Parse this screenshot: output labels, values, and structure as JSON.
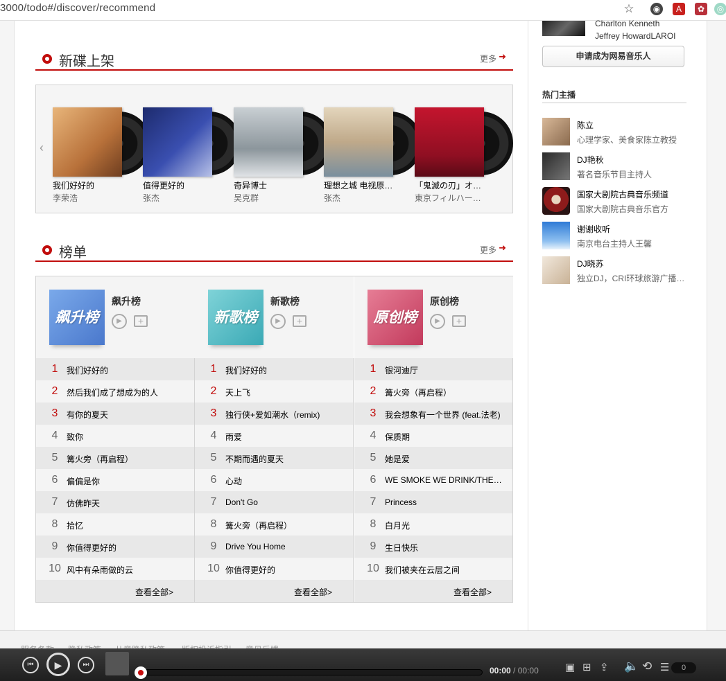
{
  "browser": {
    "url": "3000/todo#/discover/recommend"
  },
  "new_albums": {
    "title": "新碟上架",
    "more": "更多",
    "items": [
      {
        "name": "我们好好的",
        "artist": "李荣浩",
        "color": "#c98a4b"
      },
      {
        "name": "值得更好的",
        "artist": "张杰",
        "color": "#2c3e8f"
      },
      {
        "name": "奇异博士",
        "artist": "吴克群",
        "color": "#9aa3a8"
      },
      {
        "name": "理想之城 电视原声带",
        "artist": "张杰",
        "color": "#d7c6a8"
      },
      {
        "name": "「鬼滅の刃」オリジナル",
        "artist": "東京フィルハーモニー交響楽団",
        "color": "#b3142b"
      }
    ]
  },
  "charts": {
    "title": "榜单",
    "more": "更多",
    "view_all": "查看全部>",
    "lists": [
      {
        "name": "飙升榜",
        "cover_text": "飙升榜",
        "cover_color": "#5b8fd9",
        "songs": [
          "我们好好的",
          "然后我们成了想成为的人",
          "有你的夏天",
          "致你",
          "篝火旁（再启程）",
          "偏偏是你",
          "仿佛昨天",
          "拾忆",
          "你值得更好的",
          "风中有朵雨做的云"
        ]
      },
      {
        "name": "新歌榜",
        "cover_text": "新歌榜",
        "cover_color": "#4fb6c0",
        "songs": [
          "我们好好的",
          "天上飞",
          "独行侠+爱如潮水（remix)",
          "雨爱",
          "不期而遇的夏天",
          "心动",
          "Don't Go",
          "篝火旁（再启程）",
          "Drive You Home",
          "你值得更好的"
        ]
      },
      {
        "name": "原创榜",
        "cover_text": "原创榜",
        "cover_color": "#cf4a6a",
        "songs": [
          "银河迪厅",
          "篝火旁（再启程）",
          "我会想象有一个世界 (feat.法老)",
          "保质期",
          "她是爱",
          "WE SMOKE WE DRINK/THEN WE",
          "Princess",
          "白月光",
          "生日快乐",
          "我们被夹在云层之间"
        ]
      }
    ],
    "ranks": [
      "1",
      "2",
      "3",
      "4",
      "5",
      "6",
      "7",
      "8",
      "9",
      "10"
    ]
  },
  "sidebar": {
    "artist_names": [
      "Charlton Kenneth",
      "Jeffrey HowardLAROI"
    ],
    "apply_button": "申请成为网易音乐人",
    "hot_dj_title": "热门主播",
    "djs": [
      {
        "name": "陈立",
        "desc": "心理学家、美食家陈立教授",
        "color": "#b58a6a"
      },
      {
        "name": "DJ艳秋",
        "desc": "著名音乐节目主持人",
        "color": "#555"
      },
      {
        "name": "国家大剧院古典音乐频道",
        "desc": "国家大剧院古典音乐官方",
        "color": "#8e1b1b"
      },
      {
        "name": "谢谢收听",
        "desc": "南京电台主持人王馨",
        "color": "#4a8fd8"
      },
      {
        "name": "DJ晓苏",
        "desc": "独立DJ，CRI环球旅游广播特邀DJ",
        "color": "#d9c7b0"
      }
    ]
  },
  "footer_links": [
    "服务条款",
    "隐私政策",
    "儿童隐私政策",
    "版权投诉指引",
    "意见反馈"
  ],
  "player": {
    "current_time": "00:00",
    "total_time": "/ 00:00",
    "count": "0"
  }
}
